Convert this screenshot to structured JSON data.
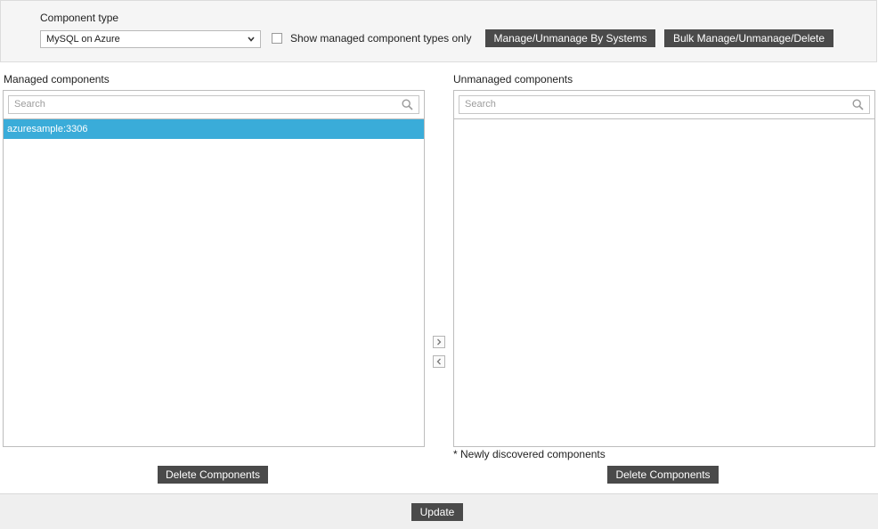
{
  "filter": {
    "component_type_label": "Component type",
    "component_type_value": "MySQL on Azure",
    "show_managed_label": "Show managed component types only",
    "show_managed_checked": false,
    "manage_by_systems_label": "Manage/Unmanage By Systems",
    "bulk_manage_label": "Bulk Manage/Unmanage/Delete"
  },
  "managed": {
    "label": "Managed components",
    "search_placeholder": "Search",
    "items": [
      "azuresample:3306"
    ],
    "selected_item": "azuresample:3306",
    "delete_label": "Delete Components"
  },
  "unmanaged": {
    "label": "Unmanaged components",
    "search_placeholder": "Search",
    "items": [],
    "note": "* Newly discovered components",
    "delete_label": "Delete Components"
  },
  "footer": {
    "update_label": "Update"
  },
  "colors": {
    "selected_row": "#3aacd9",
    "button_bg": "#4a4a4a"
  },
  "icons": {
    "move_right": "chevron-right-icon",
    "move_left": "chevron-left-icon",
    "search": "search-icon",
    "dropdown": "chevron-down-icon"
  }
}
